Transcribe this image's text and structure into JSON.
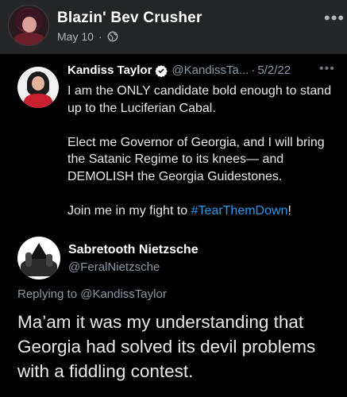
{
  "fb_post": {
    "author_name": "Blazin' Bev Crusher",
    "date": "May 10",
    "separator": "·",
    "audience_icon": "globe-icon",
    "more_label": "•••"
  },
  "tweet": {
    "author_name": "Kandiss Taylor",
    "handle": "@KandissTa...",
    "separator": "·",
    "date": "5/2/22",
    "verified_icon": "verified-badge-icon",
    "more_label": "•••",
    "paragraphs": [
      "I am the ONLY candidate bold enough to stand up to the Luciferian Cabal.",
      "Elect me Governor of Georgia, and I will bring the Satanic Regime to its knees— and DEMOLISH the Georgia Guidestones."
    ],
    "last_paragraph_prefix": "Join me in my fight to ",
    "hashtag": "#TearThemDown",
    "last_paragraph_suffix": "!"
  },
  "reply": {
    "author_name": "Sabretooth Nietzsche",
    "handle": "@FeralNietzsche",
    "replying_prefix": "Replying to ",
    "replying_mention": "@KandissTaylor",
    "text": "Ma’am it was my understanding that Georgia had solved its devil problems with a fiddling contest."
  },
  "colors": {
    "facebook_bg": "#242526",
    "card_bg": "#000000",
    "link_blue": "#1d9bf0",
    "muted_text": "#8b98a5"
  }
}
